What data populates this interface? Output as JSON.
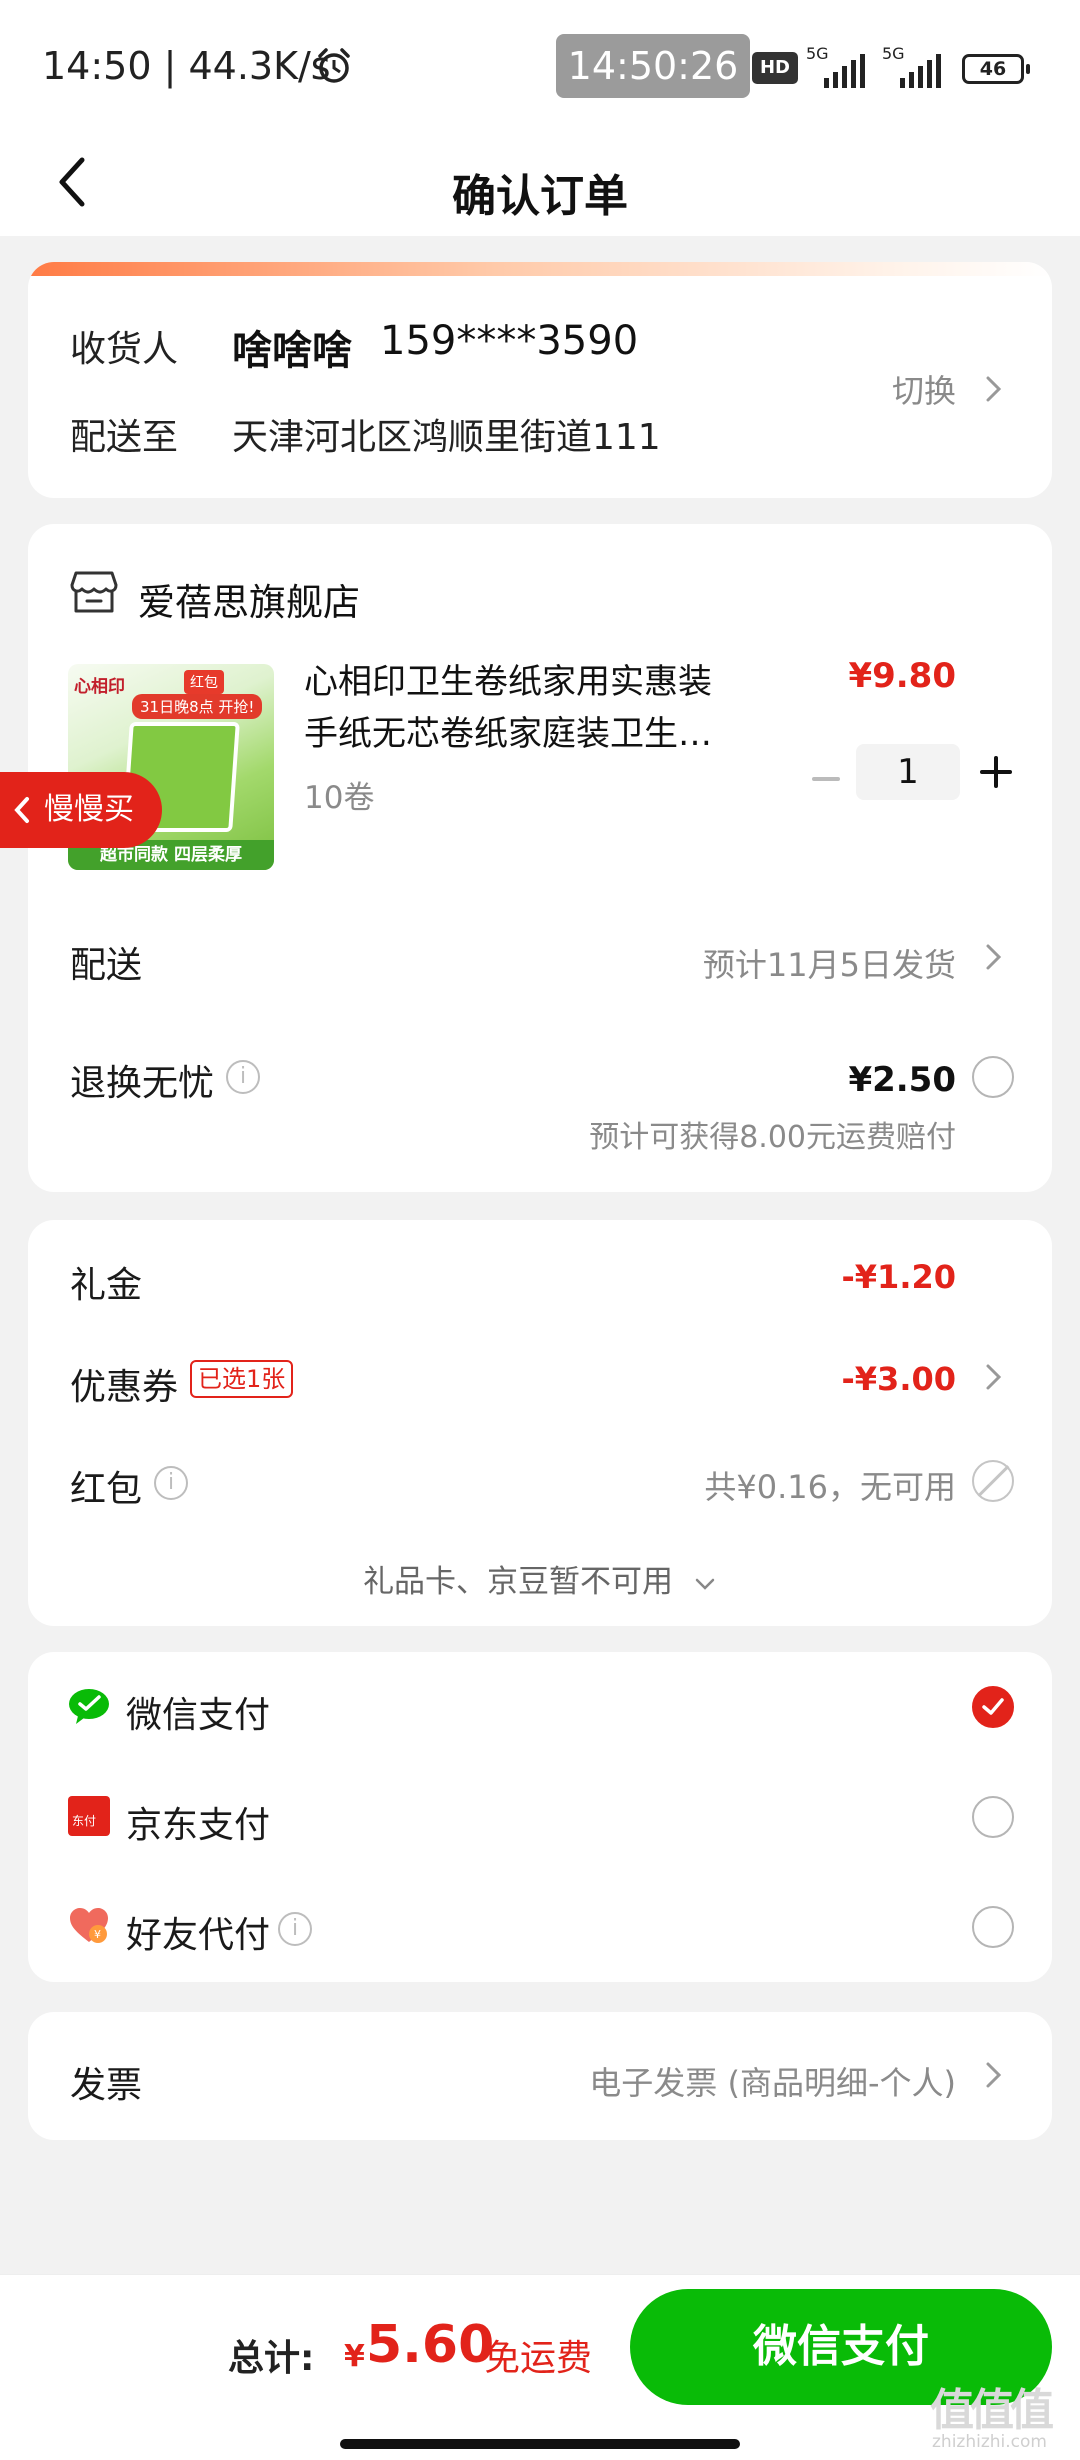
{
  "status_bar": {
    "time_speed": "14:50 | 44.3K/s",
    "clock_badge": "14:50:26",
    "hd_label": "HD",
    "network_1": "5G",
    "network_2": "5G",
    "battery": "46"
  },
  "nav": {
    "title": "确认订单"
  },
  "address": {
    "receiver_label": "收货人",
    "receiver_name": "啥啥啥",
    "receiver_phone": "159****3590",
    "deliver_label": "配送至",
    "deliver_address": "天津河北区鸿顺里街道111",
    "switch_label": "切换"
  },
  "store": {
    "name": "爱蓓思旗舰店"
  },
  "product": {
    "title_line1": "心相印卫生卷纸家用实惠装",
    "title_line2": "手纸无芯卷纸家庭装卫生…",
    "spec": "10卷",
    "price": "¥9.80",
    "quantity": "1",
    "image_logo": "心相印",
    "image_tag": "红包",
    "image_banner": "31日晚8点 开抢!",
    "image_bottom": "超市同款 四层柔厚"
  },
  "slow_buy": {
    "label": "慢慢买"
  },
  "shipping": {
    "label": "配送",
    "value": "预计11月5日发货"
  },
  "return_insurance": {
    "label": "退换无忧",
    "price": "¥2.50",
    "note": "预计可获得8.00元运费赔付"
  },
  "discounts": {
    "gift_label": "礼金",
    "gift_amount": "-¥1.20",
    "coupon_label": "优惠券",
    "coupon_badge": "已选1张",
    "coupon_amount": "-¥3.00",
    "redpacket_label": "红包",
    "redpacket_value": "共¥0.16，无可用",
    "more_label": "礼品卡、京豆暂不可用"
  },
  "payment": {
    "methods": [
      {
        "label": "微信支付",
        "selected": true
      },
      {
        "label": "京东支付",
        "selected": false
      },
      {
        "label": "好友代付",
        "selected": false
      }
    ],
    "jd_icon_text": "东付"
  },
  "invoice": {
    "label": "发票",
    "value": "电子发票 (商品明细-个人)"
  },
  "bottom": {
    "total_label": "总计:",
    "currency": "¥",
    "total_amount": "5.60",
    "free_shipping": "免运费",
    "pay_button": "微信支付"
  },
  "watermark": {
    "big": "值值值",
    "small": "zhizhizhi.com"
  },
  "colors": {
    "accent_red": "#e2231a",
    "wechat_green": "#09bb07",
    "background": "#f2f2f2"
  }
}
